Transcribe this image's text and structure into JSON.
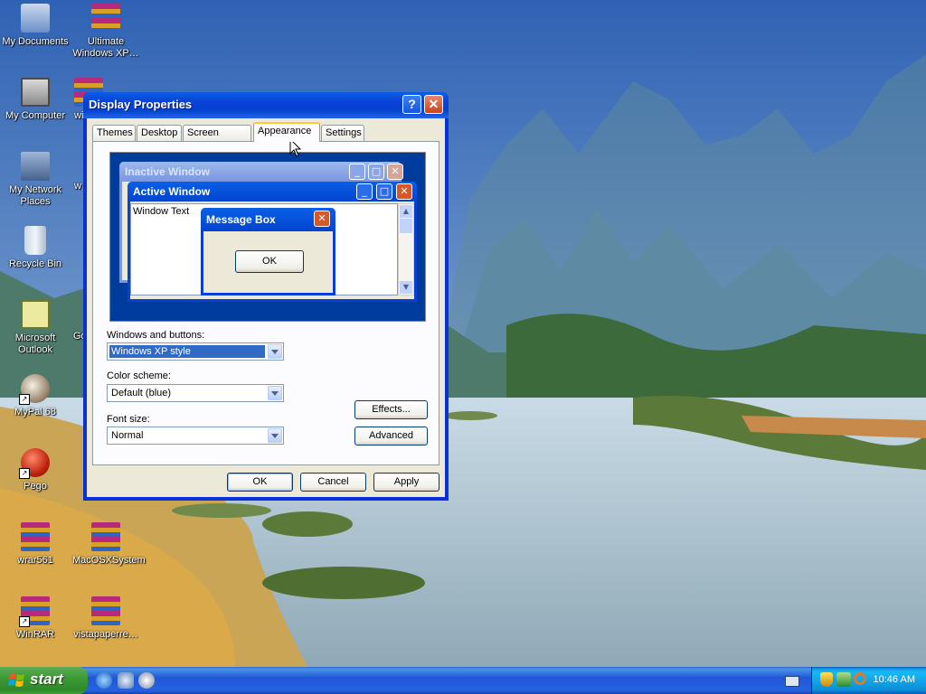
{
  "desktop": {
    "icons": [
      {
        "label": "My Documents"
      },
      {
        "label": "Ultimate Windows XP…"
      },
      {
        "label": "My Computer"
      },
      {
        "label": "wi"
      },
      {
        "label": "My Network Places"
      },
      {
        "label": "w"
      },
      {
        "label": "Recycle Bin"
      },
      {
        "label": "Microsoft Outlook"
      },
      {
        "label": "Go"
      },
      {
        "label": "MyPal 68"
      },
      {
        "label": "Pego"
      },
      {
        "label": "wrar561"
      },
      {
        "label": "MacOSXSystem"
      },
      {
        "label": "WinRAR"
      },
      {
        "label": "vistapaperre…"
      }
    ]
  },
  "window": {
    "title": "Display Properties",
    "help_glyph": "?",
    "close_glyph": "✕",
    "tabs": [
      {
        "label": "Themes"
      },
      {
        "label": "Desktop"
      },
      {
        "label": "Screen Saver"
      },
      {
        "label": "Appearance"
      },
      {
        "label": "Settings"
      }
    ],
    "preview": {
      "inactive_title": "Inactive Window",
      "active_title": "Active Window",
      "window_text": "Window Text",
      "message_title": "Message Box",
      "message_ok": "OK"
    },
    "form": {
      "windows_buttons_label": "Windows and buttons:",
      "windows_buttons_value": "Windows XP style",
      "color_scheme_label": "Color scheme:",
      "color_scheme_value": "Default (blue)",
      "font_size_label": "Font size:",
      "font_size_value": "Normal",
      "effects_button": "Effects...",
      "advanced_button": "Advanced"
    },
    "buttons": {
      "ok": "OK",
      "cancel": "Cancel",
      "apply": "Apply"
    }
  },
  "taskbar": {
    "start_label": "start",
    "clock": "10:46 AM"
  },
  "colors": {
    "xp_blue": "#0831d9",
    "start_green": "#3c9a34",
    "tray_blue": "#0c8ed8",
    "dialog_face": "#ece9d8",
    "tab_highlight": "#ffc73c"
  }
}
